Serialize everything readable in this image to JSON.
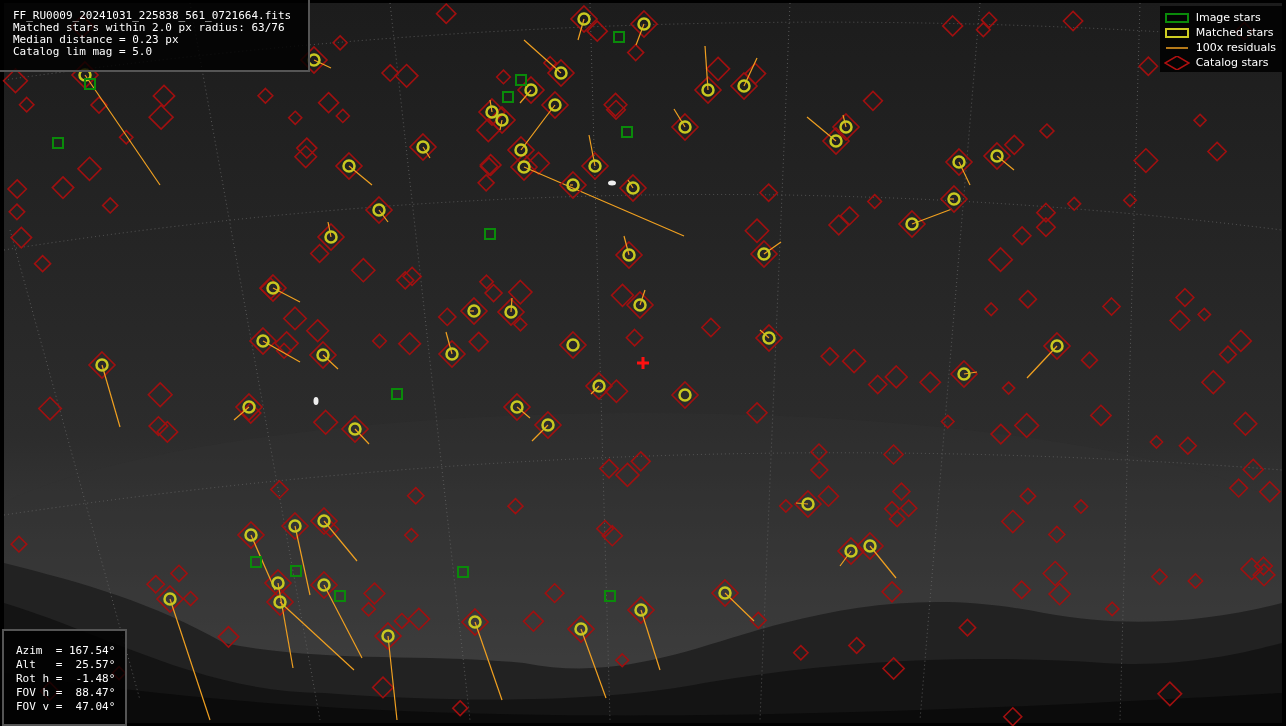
{
  "file_info": {
    "lines": [
      "FF_RU0009_20241031_225838_561_0721664.fits",
      "Matched stars within 2.0 px radius: 63/76",
      "Median distance = 0.23 px",
      "Catalog lim mag = 5.0"
    ]
  },
  "legend": [
    {
      "label": "Image stars"
    },
    {
      "kind": "matched",
      "label": "Matched stars"
    },
    {
      "kind": "residual",
      "label": "100x residuals"
    },
    {
      "kind": "catalog",
      "label": "Catalog stars"
    }
  ],
  "pointing": {
    "lines": [
      "Azim  = 167.54°",
      "Alt   =  25.57°",
      "Rot h =  -1.48°",
      "FOV h =  88.47°",
      "FOV v =  47.04°"
    ]
  }
}
